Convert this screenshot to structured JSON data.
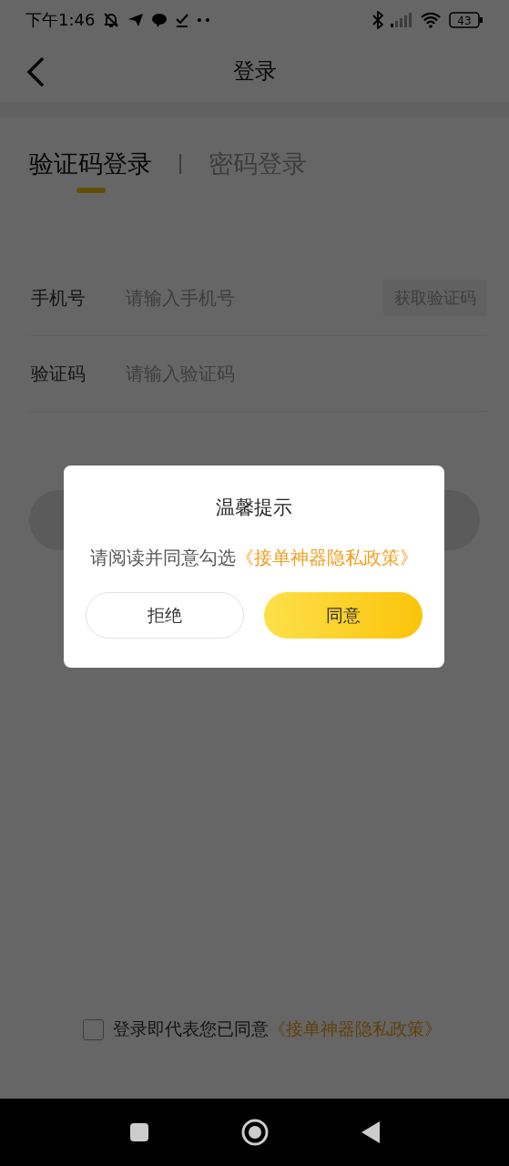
{
  "status_bar": {
    "time": "下午1:46",
    "battery": "43"
  },
  "header": {
    "title": "登录"
  },
  "tabs": [
    {
      "label": "验证码登录",
      "selected": true
    },
    {
      "label": "密码登录",
      "selected": false
    }
  ],
  "fields": [
    {
      "label": "手机号",
      "placeholder": "请输入手机号",
      "action": "获取验证码"
    },
    {
      "label": "验证码",
      "placeholder": "请输入验证码"
    }
  ],
  "agreement": {
    "checked": false,
    "text": "登录即代表您已同意",
    "link": "《接单神器隐私政策》"
  },
  "dialog": {
    "title": "温馨提示",
    "message": "请阅读并同意勾选",
    "link": "《接单神器隐私政策》",
    "buttons": [
      {
        "label": "拒绝",
        "kind": "secondary"
      },
      {
        "label": "同意",
        "kind": "primary"
      }
    ]
  }
}
